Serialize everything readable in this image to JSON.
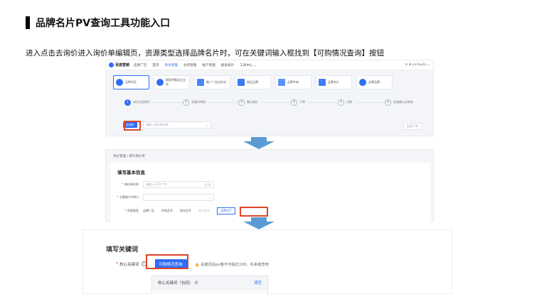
{
  "doc": {
    "title": "品牌名片PV查询工具功能入口",
    "description": "进入点击去询价进入询价单编辑页，资源类型选择品牌名片时，可在关键词输入框找到【可购情况查询】按钮"
  },
  "shot1": {
    "logo": "百度营销",
    "nav": [
      "品牌广告",
      "首页",
      "询价管理",
      "合同管理",
      "账户管理",
      "报表统计",
      "工具中心 ⌄"
    ],
    "nav_right": "⊙ ⊕ yv-liuyfu ⌄",
    "cards": [
      {
        "label": "品牌专区",
        "color": "#2f6df6"
      },
      {
        "label": "搜索特殊区位业务",
        "color": "#2f6df6"
      },
      {
        "label": "推广广告位样式",
        "color": "#2f6df6"
      },
      {
        "label": "商品品牌",
        "color": "#2f6df6"
      },
      {
        "label": "品牌专有",
        "color": "#2f6df6"
      },
      {
        "label": "品牌名片",
        "color": "#2f6df6"
      },
      {
        "label": "品牌品牌",
        "color": "#2f6df6"
      }
    ],
    "steps": [
      {
        "num": "1",
        "label": "询价信息填写"
      },
      {
        "num": "2",
        "label": "关键词审核"
      },
      {
        "num": "3",
        "label": "确认报价"
      },
      {
        "num": "4",
        "label": "下单"
      },
      {
        "num": "5",
        "label": "付款"
      },
      {
        "num": "6",
        "label": "投放确认及审核"
      }
    ],
    "query_button": "去询价",
    "search_placeholder": "请输入询价单名称",
    "search_icon": "⌕",
    "right_button": "批量下单"
  },
  "shot2": {
    "breadcrumb": "询价管理 / 填写询价单",
    "panel_title": "填写基本信息",
    "name_label": "* 询价单名称",
    "name_placeholder": "请输入1-30个字",
    "name_count": "0/30",
    "account_label": "* 主题账户(URL)",
    "account_chevron": "⌄",
    "type_label": "* 资源类型",
    "type_options": [
      "品牌广告",
      "时段品专",
      "阳光品专",
      "知识品专"
    ],
    "type_selected": "品牌名片"
  },
  "shot3": {
    "title": "填写关键词",
    "label": "核心关键词",
    "required_mark": "*",
    "help": "?",
    "button": "可购情况查询",
    "warn_icon": "▲",
    "hint": "关键词总pv量不可超过100，先来者查吧",
    "table_header": "核心关键词（包括）",
    "table_help": "⓪",
    "table_action": "清空"
  },
  "colors": {
    "primary": "#2f6df6",
    "highlight": "#e0442a",
    "arrow": "#5b9bd5"
  }
}
